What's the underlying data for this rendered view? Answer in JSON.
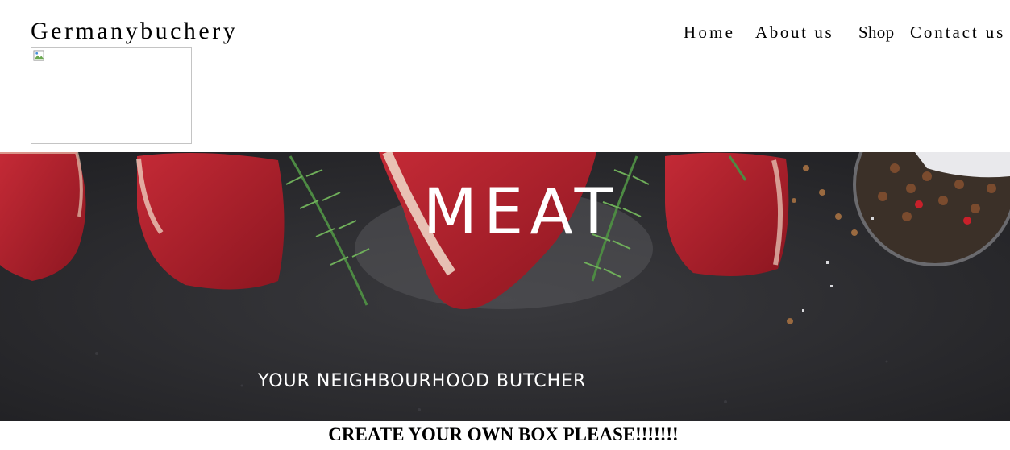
{
  "brand": {
    "name": "Germanybuchery"
  },
  "nav": {
    "items": [
      {
        "label": "Home"
      },
      {
        "label": "About us"
      },
      {
        "label": "Shop"
      },
      {
        "label": "Contact us"
      }
    ]
  },
  "hero": {
    "title": "MEAT",
    "subtitle": "YOUR NEIGHBOURHOOD BUTCHER"
  },
  "main": {
    "heading": "CREATE YOUR OWN BOX PLEASE!!!!!!!"
  },
  "colors": {
    "background": "#ffffff",
    "hero_background": "#2a2a2d",
    "meat_red": "#b3202c",
    "rosemary_green": "#3f7a3a",
    "text": "#000000"
  }
}
